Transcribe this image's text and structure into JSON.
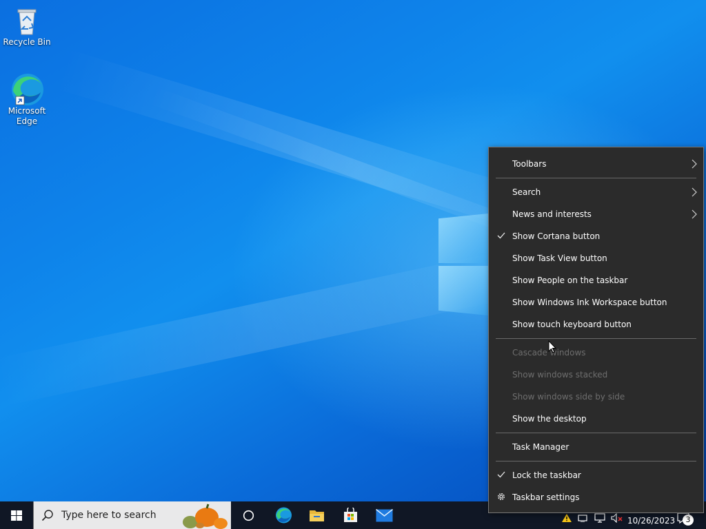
{
  "desktop": {
    "icons": [
      {
        "label": "Recycle Bin"
      },
      {
        "label": "Microsoft\nEdge"
      }
    ]
  },
  "context_menu": {
    "items": [
      {
        "label": "Toolbars",
        "submenu": true
      },
      {
        "label": "Search",
        "submenu": true
      },
      {
        "label": "News and interests",
        "submenu": true
      },
      {
        "label": "Show Cortana button",
        "checked": true
      },
      {
        "label": "Show Task View button"
      },
      {
        "label": "Show People on the taskbar"
      },
      {
        "label": "Show Windows Ink Workspace button"
      },
      {
        "label": "Show touch keyboard button"
      },
      {
        "label": "Cascade windows",
        "disabled": true
      },
      {
        "label": "Show windows stacked",
        "disabled": true
      },
      {
        "label": "Show windows side by side",
        "disabled": true
      },
      {
        "label": "Show the desktop"
      },
      {
        "label": "Task Manager"
      },
      {
        "label": "Lock the taskbar",
        "checked": true
      },
      {
        "label": "Taskbar settings",
        "icon": "gear-icon"
      }
    ]
  },
  "taskbar": {
    "search_placeholder": "Type here to search",
    "pinned": [
      "cortana-icon",
      "edge-icon",
      "file-explorer-icon",
      "store-icon",
      "mail-icon"
    ],
    "date": "10/26/2023",
    "notification_count": "3"
  },
  "colors": {
    "menu_bg": "#2b2b2b",
    "menu_disabled": "#6e6e6e",
    "taskbar_bg": "#101725"
  }
}
